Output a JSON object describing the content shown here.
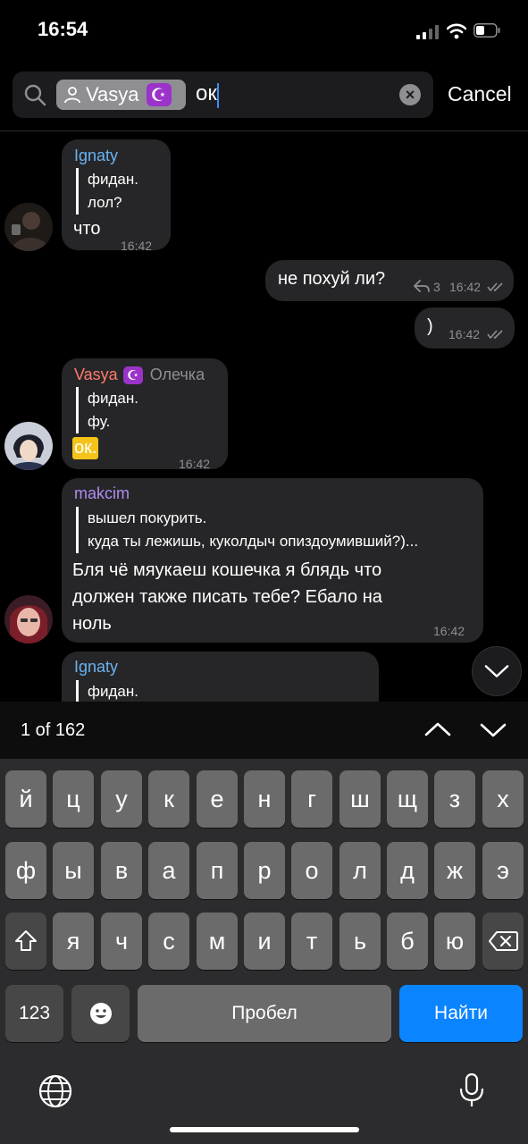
{
  "status_bar": {
    "time": "16:54"
  },
  "search": {
    "chip_name": "Vasya",
    "chip_emoji": "☪",
    "query": "ок",
    "clear_glyph": "×",
    "cancel_label": "Cancel"
  },
  "messages": [
    {
      "type": "incoming",
      "sender": "Ignaty",
      "quote_line1": "фидан.",
      "quote_line2": "лол?",
      "text": "что",
      "time": "16:42"
    },
    {
      "type": "outgoing",
      "text": "не похуй ли?",
      "replies": "3",
      "time": "16:42"
    },
    {
      "type": "outgoing",
      "text": ")",
      "time": "16:42"
    },
    {
      "type": "incoming",
      "sender": "Vasya",
      "sender_emoji": "☪",
      "sender_title": "Олечка",
      "quote_line1": "фидан.",
      "quote_line2": "фу.",
      "text": "ок.",
      "time": "16:42"
    },
    {
      "type": "incoming",
      "sender": "makcim",
      "quote_line1": "вышел покурить.",
      "quote_line2": "куда ты лежишь, куколдыч опиздоумивший?)...",
      "text_line1": "Бля чё мяукаеш кошечка я блядь что",
      "text_line2": "должен также писать тебе? Ебало на",
      "text_line3": "ноль",
      "time": "16:42"
    },
    {
      "type": "incoming",
      "sender": "Ignaty",
      "quote_line1": "фидан."
    }
  ],
  "results": {
    "count_text": "1 of 162"
  },
  "keyboard": {
    "row1": [
      "й",
      "ц",
      "у",
      "к",
      "е",
      "н",
      "г",
      "ш",
      "щ",
      "з",
      "х"
    ],
    "row2": [
      "ф",
      "ы",
      "в",
      "а",
      "п",
      "р",
      "о",
      "л",
      "д",
      "ж",
      "э"
    ],
    "row3": [
      "я",
      "ч",
      "с",
      "м",
      "и",
      "т",
      "ь",
      "б",
      "ю"
    ],
    "numbers_label": "123",
    "space_label": "Пробел",
    "return_label": "Найти"
  },
  "colors": {
    "accent": "#0a84ff",
    "bubble": "#262628",
    "ignaty_name": "#6ab2f2",
    "vasya_name": "#ff7b6b",
    "makcim_name": "#b18cf0",
    "highlight": "#f5c41a"
  }
}
